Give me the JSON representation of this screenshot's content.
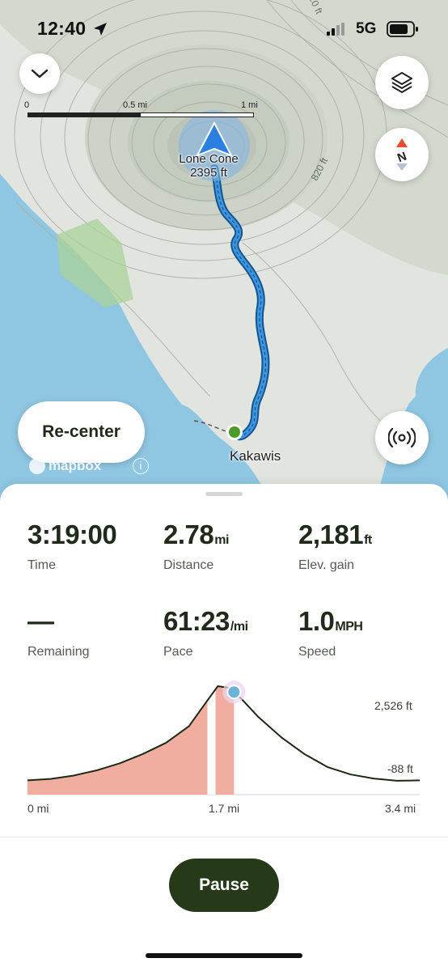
{
  "status_bar": {
    "time": "12:40",
    "network": "5G"
  },
  "map": {
    "scale": {
      "labels": [
        "0",
        "0.5 mi",
        "1 mi"
      ]
    },
    "peak": {
      "name": "Lone Cone",
      "elevation": "2395 ft"
    },
    "place": "Kakawis",
    "contours": [
      "620 ft",
      "820 ft"
    ],
    "attribution": "mapbox",
    "recenter_label": "Re-center",
    "colors": {
      "water": "#8fc6e2",
      "land": "#e2e5df",
      "route": "#2f86d6",
      "park": "#a9d29a"
    },
    "icons": {
      "collapse": "chevron-down-icon",
      "layers": "layers-icon",
      "compass": "compass-icon",
      "broadcast": "broadcast-icon"
    }
  },
  "stats": {
    "time": {
      "value": "3:19:00",
      "unit": "",
      "label": "Time"
    },
    "distance": {
      "value": "2.78",
      "unit": "mi",
      "label": "Distance"
    },
    "elev_gain": {
      "value": "2,181",
      "unit": "ft",
      "label": "Elev. gain"
    },
    "remaining": {
      "value": "—",
      "unit": "",
      "label": "Remaining"
    },
    "pace": {
      "value": "61:23",
      "unit": "/mi",
      "label": "Pace"
    },
    "speed": {
      "value": "1.0",
      "unit": "MPH",
      "label": "Speed"
    }
  },
  "chart_data": {
    "type": "area",
    "y_ticks": [
      "2,526 ft",
      "-88 ft"
    ],
    "x_ticks": [
      "0 mi",
      "1.7 mi",
      "3.4 mi"
    ],
    "x": [
      0,
      0.2,
      0.4,
      0.6,
      0.8,
      1.0,
      1.2,
      1.4,
      1.55,
      1.65,
      1.75,
      1.85,
      2.0,
      2.2,
      2.4,
      2.6,
      2.8,
      3.0,
      3.2,
      3.4
    ],
    "y": [
      -10,
      30,
      120,
      260,
      450,
      700,
      1000,
      1450,
      2100,
      2526,
      2480,
      2200,
      1700,
      1150,
      700,
      350,
      150,
      40,
      -20,
      -10
    ],
    "current_x": 1.79,
    "colors": {
      "line": "#1c2a14",
      "fill": "#f1ada0",
      "marker": "#6bb3d8"
    }
  },
  "pause_label": "Pause"
}
